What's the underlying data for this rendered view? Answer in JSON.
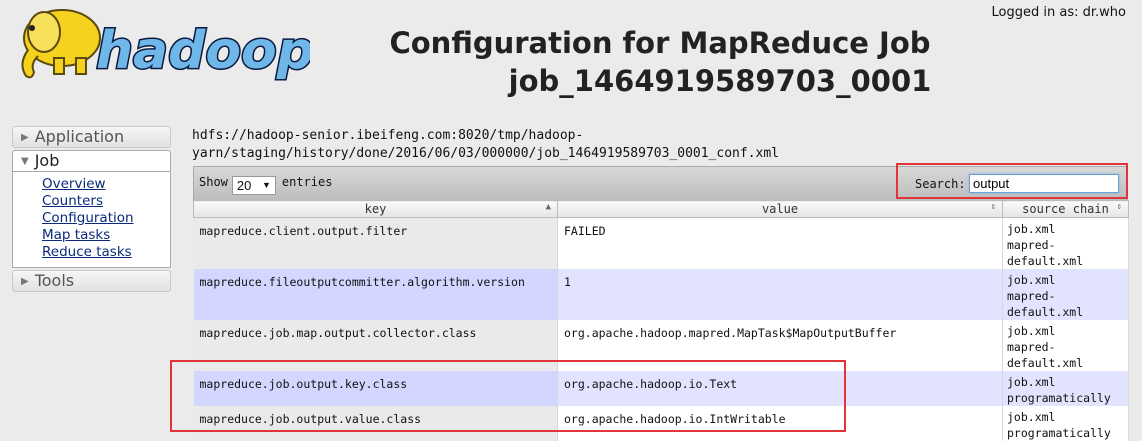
{
  "header": {
    "logged_in": "Logged in as: dr.who",
    "title_line1": "Configuration for MapReduce Job",
    "title_line2": "job_1464919589703_0001",
    "logo_text": "hadoop"
  },
  "nav": {
    "application": "Application",
    "job": "Job",
    "job_links": [
      "Overview",
      "Counters",
      "Configuration",
      "Map tasks",
      "Reduce tasks"
    ],
    "tools": "Tools"
  },
  "conf_path": {
    "line1": "hdfs://hadoop-senior.ibeifeng.com:8020/tmp/hadoop-",
    "line2": "yarn/staging/history/done/2016/06/03/000000/job_1464919589703_0001_conf.xml"
  },
  "toolbar": {
    "show_label": "Show",
    "entries_value": "20",
    "entries_label": "entries",
    "search_label": "Search:",
    "search_value": "output"
  },
  "columns": [
    "key",
    "value",
    "source chain"
  ],
  "rows": [
    {
      "key": "mapreduce.client.output.filter",
      "value": "FAILED",
      "source": [
        "job.xml",
        "mapred-",
        "default.xml"
      ]
    },
    {
      "key": "mapreduce.fileoutputcommitter.algorithm.version",
      "value": "1",
      "source": [
        "job.xml",
        "mapred-",
        "default.xml"
      ]
    },
    {
      "key": "mapreduce.job.map.output.collector.class",
      "value": "org.apache.hadoop.mapred.MapTask$MapOutputBuffer",
      "source": [
        "job.xml",
        "mapred-",
        "default.xml"
      ]
    },
    {
      "key": "mapreduce.job.output.key.class",
      "value": "org.apache.hadoop.io.Text",
      "source": [
        "job.xml",
        "programatically"
      ]
    },
    {
      "key": "mapreduce.job.output.value.class",
      "value": "org.apache.hadoop.io.IntWritable",
      "source": [
        "job.xml",
        "programatically"
      ]
    }
  ],
  "colors": {
    "highlight_red": "#e0353b",
    "row_even": "#e2e4ff",
    "link": "#0a2a7a"
  },
  "icons": [
    "elephant-logo-icon",
    "triangle-right-icon",
    "triangle-down-icon",
    "dropdown-arrow-icon",
    "sort-asc-icon",
    "sort-both-icon"
  ]
}
